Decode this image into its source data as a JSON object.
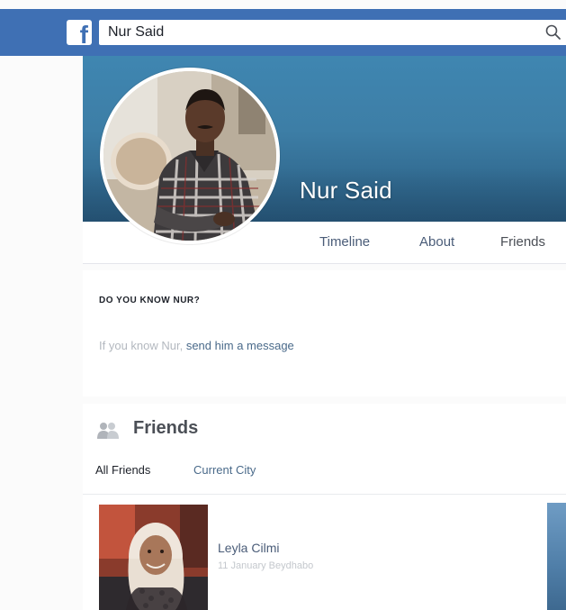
{
  "topbar": {
    "logo_letter": "f",
    "search": {
      "value": "Nur Said",
      "icon": "search-icon"
    }
  },
  "profile": {
    "name": "Nur Said"
  },
  "tabs": [
    {
      "label": "Timeline"
    },
    {
      "label": "About"
    },
    {
      "label": "Friends"
    }
  ],
  "know_card": {
    "title": "DO YOU KNOW NUR?",
    "text_prefix": "If you know Nur, ",
    "link_text": "send him a message"
  },
  "friends": {
    "title": "Friends",
    "icon": "friends-icon",
    "sub_tabs": [
      {
        "label": "All Friends"
      },
      {
        "label": "Current City"
      }
    ],
    "list": [
      {
        "name": "Leyla Cilmi",
        "meta": "11 January Beydhabo"
      }
    ]
  },
  "colors": {
    "topbar": "#3f70b4",
    "cover": "#3d7ea6",
    "link": "#4a6a8a"
  }
}
